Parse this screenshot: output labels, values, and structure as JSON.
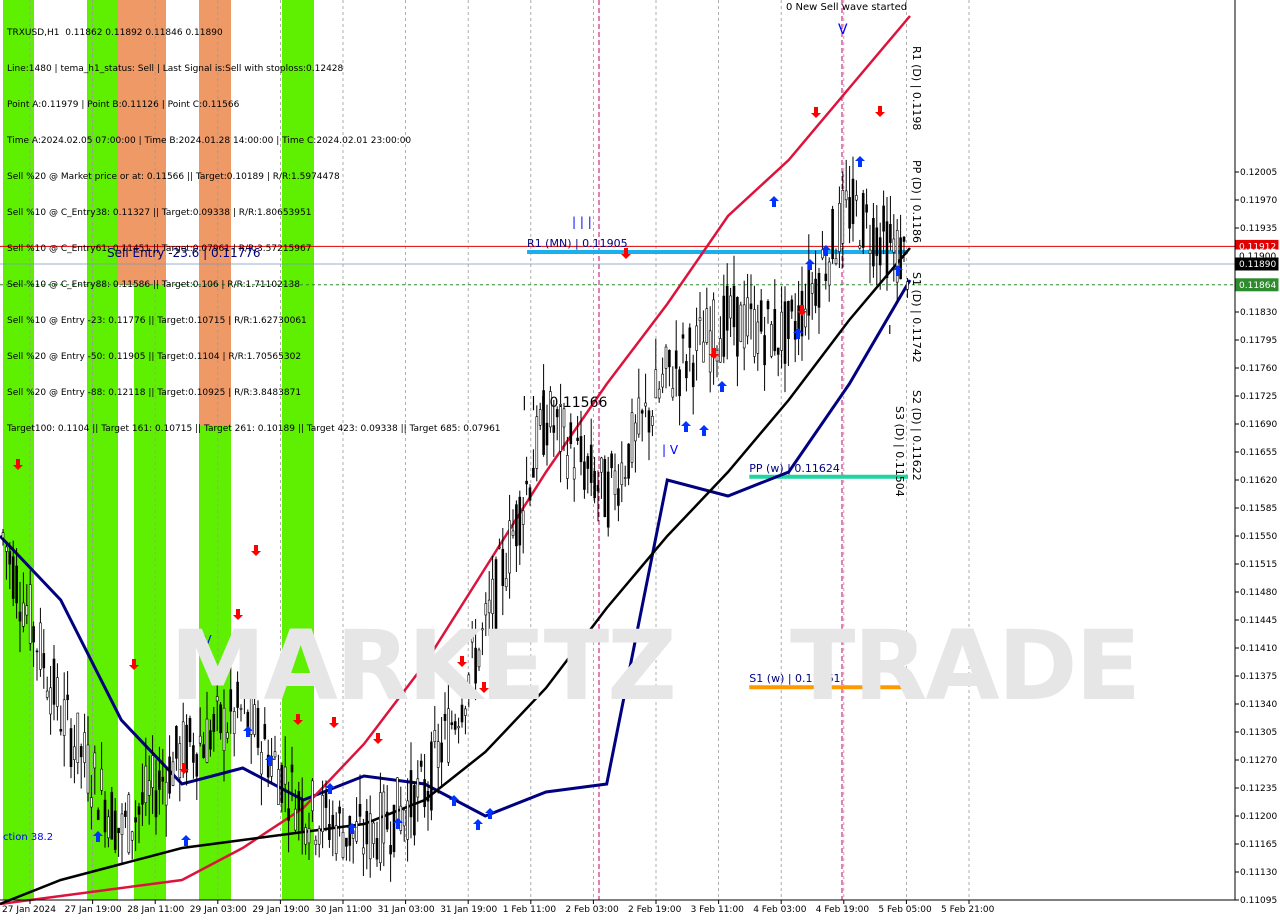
{
  "symbol_line": "TRXUSD,H1  0.11862 0.11892 0.11846 0.11890",
  "info_lines": [
    "Line:1480 | tema_h1_status: Sell | Last Signal is:Sell with stoploss:0.12428",
    "Point A:0.11979 | Point B:0.11126 | Point C:0.11566",
    "Time A:2024.02.05 07:00:00 | Time B:2024.01.28 14:00:00 | Time C:2024.02.01 23:00:00",
    "Sell %20 @ Market price or at: 0.11566 || Target:0.10189 | R/R:1.5974478",
    "Sell %10 @ C_Entry38: 0.11327 || Target:0.09338 | R/R:1.80653951",
    "Sell %10 @ C_Entry61: 0.11451 || Target:0.07961 | R/R:3.57215967",
    "Sell %10 @ C_Entry88: 0.11586 || Target:0.106 | R/R:1.71102138",
    "Sell %10 @ Entry -23: 0.11776 || Target:0.10715 | R/R:1.62730061",
    "Sell %20 @ Entry -50: 0.11905 || Target:0.1104 | R/R:1.70565302",
    "Sell %20 @ Entry -88: 0.12118 || Target:0.10925 | R/R:3.8483871",
    "Target100: 0.1104 || Target 161: 0.10715 || Target 261: 0.10189 || Target 423: 0.09338 || Target 685: 0.07961"
  ],
  "watermark": {
    "left": "MARKETZ",
    "right": "TRADE"
  },
  "chart_data": {
    "type": "line",
    "title": "TRXUSD,H1",
    "ylim": [
      0.11095,
      0.1222
    ],
    "y_ticks": [
      "0.12005",
      "0.11970",
      "0.11935",
      "0.11900",
      "0.11865",
      "0.11830",
      "0.11795",
      "0.11760",
      "0.11725",
      "0.11690",
      "0.11655",
      "0.11620",
      "0.11585",
      "0.11550",
      "0.11515",
      "0.11480",
      "0.11445",
      "0.11410",
      "0.11375",
      "0.11340",
      "0.11305",
      "0.11270",
      "0.11235",
      "0.11200",
      "0.11165",
      "0.11130",
      "0.11095"
    ],
    "x_labels": [
      "27 Jan 2024",
      "27 Jan 19:00",
      "28 Jan 11:00",
      "29 Jan 03:00",
      "29 Jan 19:00",
      "30 Jan 11:00",
      "31 Jan 03:00",
      "31 Jan 19:00",
      "1 Feb 11:00",
      "2 Feb 03:00",
      "2 Feb 19:00",
      "3 Feb 11:00",
      "4 Feb 03:00",
      "4 Feb 19:00",
      "5 Feb 05:00",
      "5 Feb 21:00"
    ],
    "price_tags": [
      {
        "label": "0.11912",
        "value": 0.11912,
        "color": "#e00000"
      },
      {
        "label": "0.11900",
        "value": 0.119,
        "color": "#ffffff"
      },
      {
        "label": "0.11890",
        "value": 0.1189,
        "color": "#000000"
      },
      {
        "label": "0.11864",
        "value": 0.11864,
        "color": "#2e8b2e"
      }
    ],
    "levels": [
      {
        "label": "R1 (MN) | 0.11905",
        "value": 0.11905,
        "color": "#1ab0ee",
        "x0": 0.415,
        "x1": 0.715
      },
      {
        "label": "PP (w) | 0.11624",
        "value": 0.11624,
        "color": "#1ed6a0",
        "x0": 0.59,
        "x1": 0.715
      },
      {
        "label": "S1 (w) | 0.11361",
        "value": 0.11361,
        "color": "#ff9900",
        "x0": 0.59,
        "x1": 0.715
      }
    ],
    "annotations": [
      {
        "text": "0 New Sell wave started"
      },
      {
        "text": "Sell Entry -23.6 | 0.11776"
      },
      {
        "text": "| | | 0.11566"
      },
      {
        "text": "| | |"
      },
      {
        "text": "| V"
      },
      {
        "text": "I V"
      },
      {
        "text": "ction 38.2"
      },
      {
        "text": "V"
      },
      {
        "text": "I"
      }
    ],
    "vertical_labels": [
      "R1 (D) | 0.1198",
      "PP (D) | 0.1186",
      "S1 (D) | 0.11742",
      "S2 (D) | 0.11622",
      "S3 (D) | 0.11504"
    ],
    "series": [
      {
        "name": "tema",
        "color": "#000080",
        "values": [
          0.1155,
          0.1147,
          0.1132,
          0.1124,
          0.1126,
          0.1122,
          0.1125,
          0.1124,
          0.112,
          0.1123,
          0.1124,
          0.1162,
          0.116,
          0.1163,
          0.1174,
          0.1187
        ]
      },
      {
        "name": "ma1",
        "color": "#dc143c",
        "values": [
          0.1109,
          0.111,
          0.1111,
          0.1112,
          0.1116,
          0.1121,
          0.1129,
          0.1139,
          0.1151,
          0.1163,
          0.1174,
          0.1184,
          0.1195,
          0.1202,
          0.1211,
          0.122
        ]
      },
      {
        "name": "ma2",
        "color": "#000000",
        "values": [
          0.1109,
          0.1112,
          0.1114,
          0.1116,
          0.1117,
          0.1118,
          0.1119,
          0.1122,
          0.1128,
          0.1136,
          0.1146,
          0.1155,
          0.1163,
          0.1172,
          0.1182,
          0.1191
        ]
      },
      {
        "name": "price",
        "color": "#000000",
        "values": [
          0.1156,
          0.1133,
          0.1118,
          0.1128,
          0.1133,
          0.1121,
          0.1117,
          0.1123,
          0.1143,
          0.117,
          0.116,
          0.1175,
          0.1182,
          0.118,
          0.1196,
          0.1189
        ]
      }
    ]
  },
  "colors": {
    "green_zone": "#5ef000",
    "salmon_zone": "#ee9966",
    "grid": "#9a9a9a",
    "pink_vline": "#c8006e"
  }
}
